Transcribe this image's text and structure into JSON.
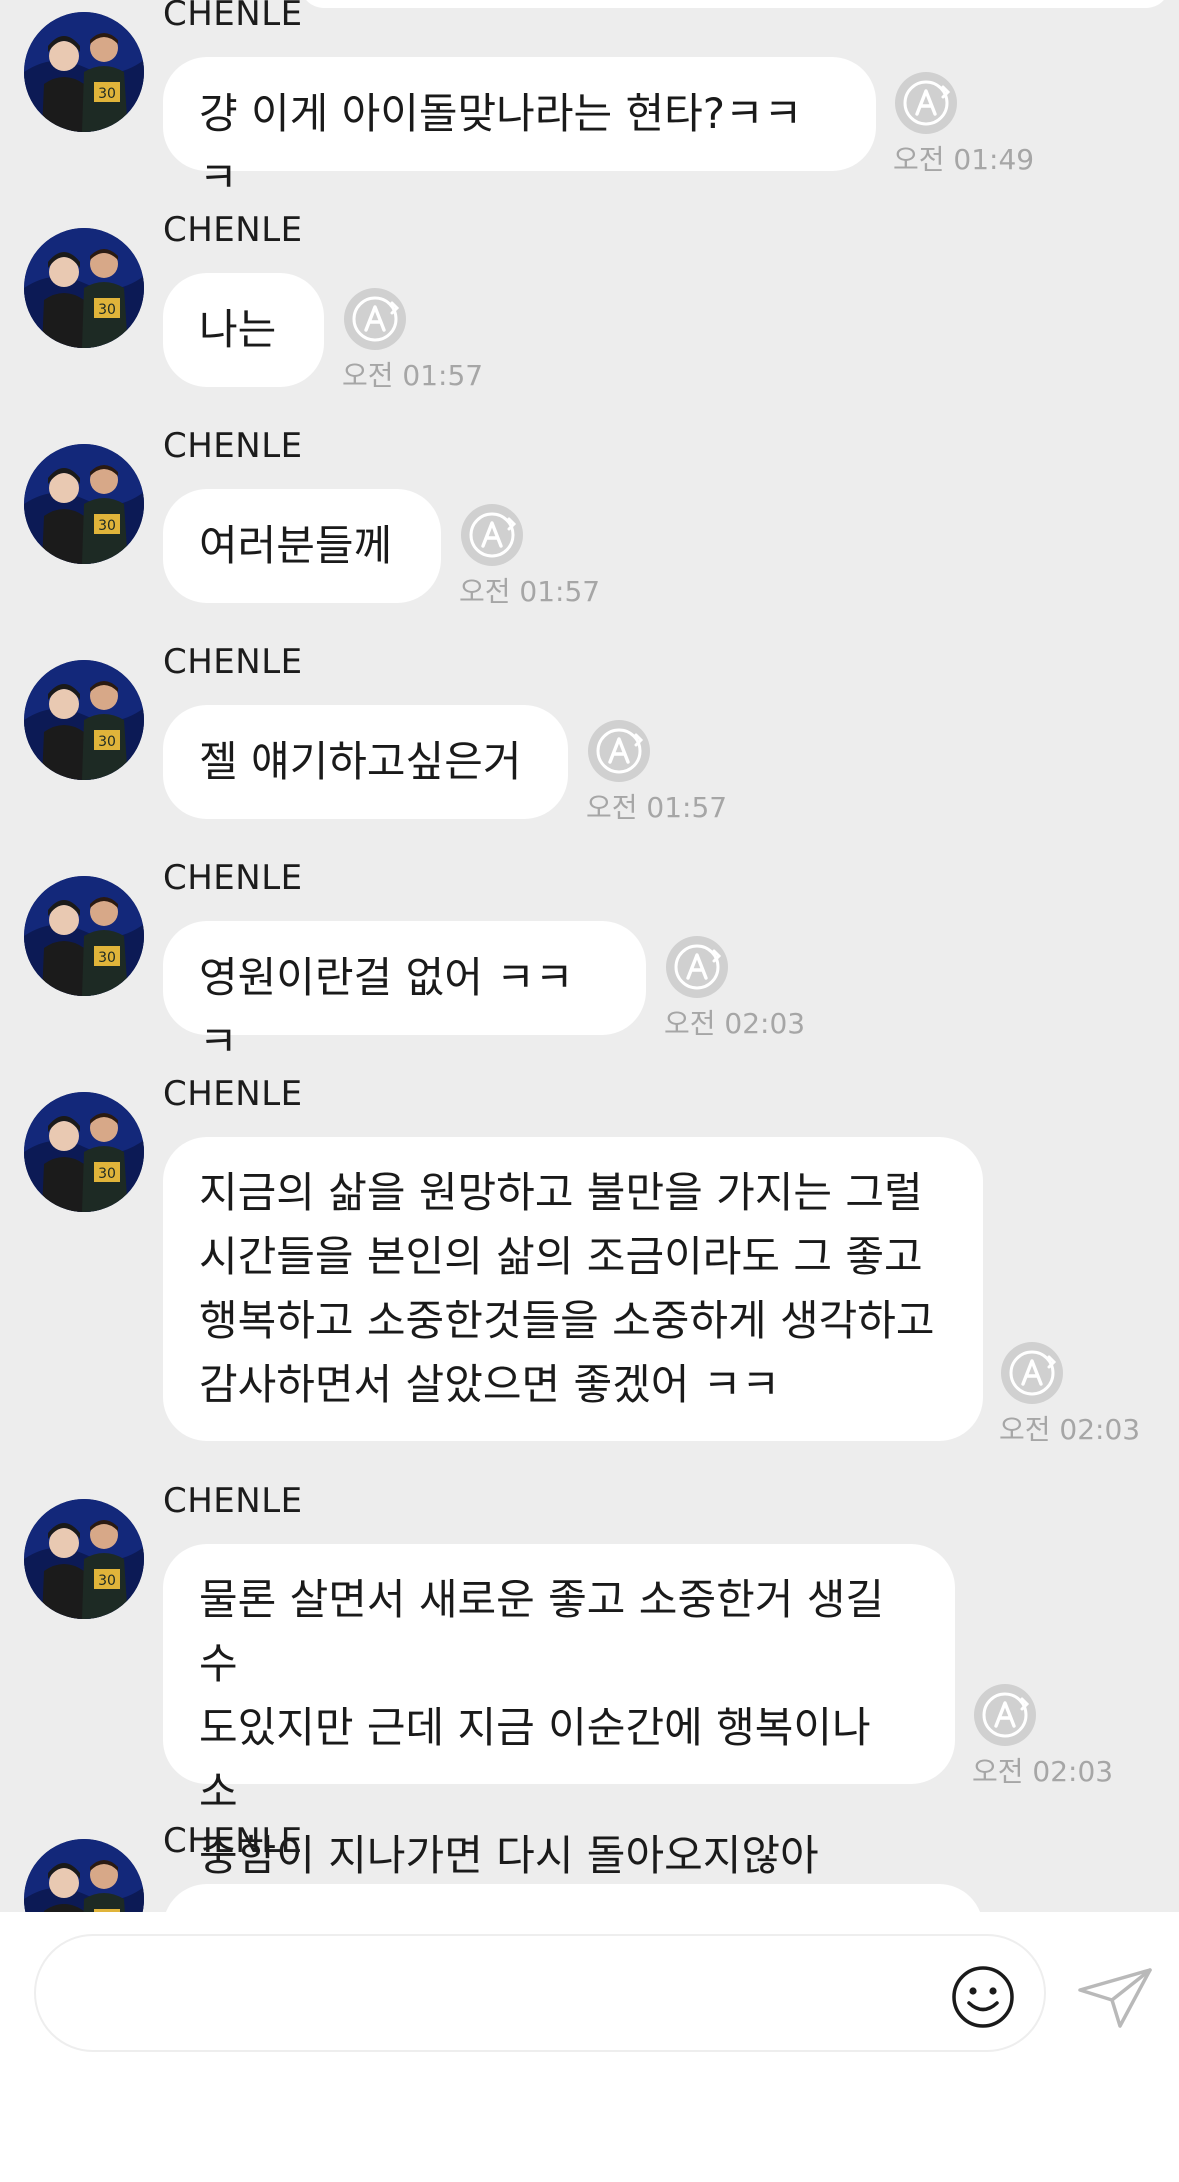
{
  "colors": {
    "background": "#ededed",
    "bubble": "#ffffff",
    "timestamp": "#a6a6a6",
    "icon_gray": "#c8c8c8"
  },
  "messages": [
    {
      "sender": "CHENLE",
      "text": "걍 이게 아이돌맞나라는 현타?ㅋㅋㅋ",
      "time": "오전 01:49",
      "icon": "auto-translate-icon"
    },
    {
      "sender": "CHENLE",
      "text": "나는",
      "time": "오전 01:57",
      "icon": "auto-translate-icon"
    },
    {
      "sender": "CHENLE",
      "text": "여러분들께",
      "time": "오전 01:57",
      "icon": "auto-translate-icon"
    },
    {
      "sender": "CHENLE",
      "text": "젤 얘기하고싶은거",
      "time": "오전 01:57",
      "icon": "auto-translate-icon"
    },
    {
      "sender": "CHENLE",
      "text": "영원이란걸 없어 ㅋㅋㅋ",
      "time": "오전 02:03",
      "icon": "auto-translate-icon"
    },
    {
      "sender": "CHENLE",
      "text": "지금의 삶을 원망하고 불만을 가지는 그럴\n시간들을 본인의 삶의 조금이라도 그 좋고\n행복하고 소중한것들을 소중하게 생각하고\n감사하면서 살았으면 좋겠어 ㅋㅋ",
      "time": "오전 02:03",
      "icon": "auto-translate-icon"
    },
    {
      "sender": "CHENLE",
      "text": "물론 살면서 새로운 좋고 소중한거 생길수\n도있지만 근데 지금 이순간에 행복이나 소\n중함이 지나가면 다시 돌아오지않아",
      "time": "오전 02:03",
      "icon": "auto-translate-icon"
    },
    {
      "sender": "CHENLE",
      "text": "",
      "time": "",
      "icon": "auto-translate-icon"
    }
  ],
  "input": {
    "placeholder": "",
    "value": ""
  },
  "icons": {
    "emoji": "smiley-icon",
    "send": "paper-plane-icon"
  }
}
